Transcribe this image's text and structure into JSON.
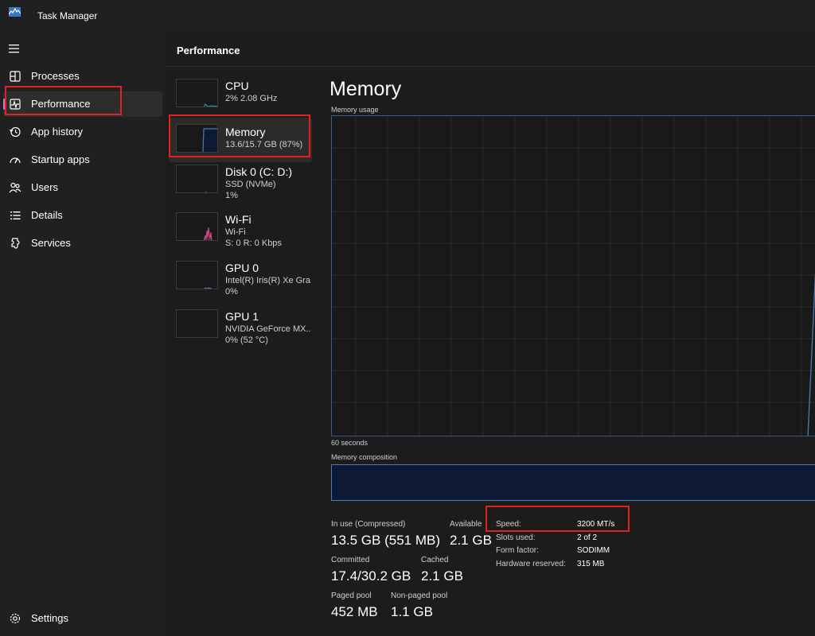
{
  "app": {
    "title": "Task Manager",
    "icon": "task-manager-icon"
  },
  "sidebar": {
    "menu_icon": "hamburger-menu-icon",
    "items": [
      {
        "label": "Processes",
        "icon": "processes-icon",
        "active": false
      },
      {
        "label": "Performance",
        "icon": "performance-icon",
        "active": true
      },
      {
        "label": "App history",
        "icon": "history-icon",
        "active": false
      },
      {
        "label": "Startup apps",
        "icon": "startup-icon",
        "active": false
      },
      {
        "label": "Users",
        "icon": "users-icon",
        "active": false
      },
      {
        "label": "Details",
        "icon": "details-icon",
        "active": false
      },
      {
        "label": "Services",
        "icon": "services-icon",
        "active": false
      }
    ],
    "settings": {
      "label": "Settings",
      "icon": "gear-icon"
    }
  },
  "main": {
    "title": "Performance"
  },
  "devices": [
    {
      "name": "CPU",
      "sub1": "2% 2.08 GHz",
      "sub2": "",
      "color": "#2aa6c6",
      "active": false
    },
    {
      "name": "Memory",
      "sub1": "13.6/15.7 GB (87%)",
      "sub2": "",
      "color": "#4f79b5",
      "active": true
    },
    {
      "name": "Disk 0 (C: D:)",
      "sub1": "SSD (NVMe)",
      "sub2": "1%",
      "color": "#8fbf3a",
      "active": false
    },
    {
      "name": "Wi-Fi",
      "sub1": "Wi-Fi",
      "sub2": "S: 0 R: 0 Kbps",
      "color": "#d04c8c",
      "active": false
    },
    {
      "name": "GPU 0",
      "sub1": "Intel(R) Iris(R) Xe Gra...",
      "sub2": "0%",
      "color": "#9b59d0",
      "active": false
    },
    {
      "name": "GPU 1",
      "sub1": "NVIDIA GeForce MX...",
      "sub2": "0% (52 °C)",
      "color": "#9b59d0",
      "active": false
    }
  ],
  "memory": {
    "title": "Memory",
    "usage_label": "Memory usage",
    "time_label": "60 seconds",
    "composition_label": "Memory composition",
    "graph_color": "#4f79b5",
    "stats": {
      "in_use_label": "In use (Compressed)",
      "in_use_value": "13.5 GB (551 MB)",
      "available_label": "Available",
      "available_value": "2.1 GB",
      "committed_label": "Committed",
      "committed_value": "17.4/30.2 GB",
      "cached_label": "Cached",
      "cached_value": "2.1 GB",
      "paged_label": "Paged pool",
      "paged_value": "452 MB",
      "nonpaged_label": "Non-paged pool",
      "nonpaged_value": "1.1 GB"
    },
    "specs": {
      "speed_label": "Speed:",
      "speed_value": "3200 MT/s",
      "slots_label": "Slots used:",
      "slots_value": "2 of 2",
      "form_label": "Form factor:",
      "form_value": "SODIMM",
      "reserved_label": "Hardware reserved:",
      "reserved_value": "315 MB"
    }
  },
  "highlight_color": "#e02222"
}
